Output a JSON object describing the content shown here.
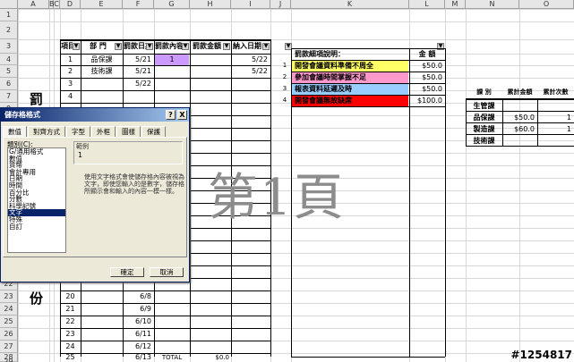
{
  "columns": [
    "A",
    "B",
    "C",
    "D",
    "E",
    "F",
    "G",
    "H",
    "I",
    "J",
    "K",
    "L",
    "M",
    "N",
    "O"
  ],
  "rows": [
    "1",
    "2",
    "3",
    "4",
    "5",
    "6",
    "7",
    "8",
    "9",
    "10",
    "11",
    "12",
    "13",
    "14",
    "15",
    "16",
    "17",
    "18",
    "19",
    "20",
    "21",
    "22",
    "23",
    "24",
    "25",
    "26",
    "27",
    "28",
    "29"
  ],
  "main_table": {
    "headers": [
      "項目",
      "部 門",
      "罰款日期",
      "罰款內容",
      "罰款金額",
      "納入日期"
    ],
    "rows": [
      [
        "1",
        "品保課",
        "5/21",
        "1",
        "",
        "5/22"
      ],
      [
        "2",
        "技術課",
        "5/21",
        "",
        "",
        "5/22"
      ],
      [
        "3",
        "",
        "5/22",
        "",
        "",
        ""
      ],
      [
        "4",
        "",
        "",
        "",
        "",
        ""
      ],
      [
        "20",
        "",
        "6/8",
        "",
        "",
        ""
      ],
      [
        "21",
        "",
        "6/9",
        "",
        "",
        ""
      ],
      [
        "22",
        "",
        "6/10",
        "",
        "",
        ""
      ],
      [
        "23",
        "",
        "6/11",
        "",
        "",
        ""
      ],
      [
        "24",
        "",
        "6/12",
        "",
        "",
        ""
      ],
      [
        "25",
        "",
        "6/13",
        "",
        "",
        ""
      ]
    ],
    "total_label": "TOTAL",
    "total_value": "$0.0"
  },
  "fine_desc": {
    "header_desc": "罰款細項說明：",
    "header_amount": "金 額",
    "items": [
      {
        "no": "1",
        "text": "開發會議資料準備不周全",
        "amount": "$50.0",
        "color": "#ffff66"
      },
      {
        "no": "2",
        "text": "參加會議時間掌握不足",
        "amount": "$50.0",
        "color": "#ff99cc"
      },
      {
        "no": "3",
        "text": "報表資料延遲及時",
        "amount": "$50.0",
        "color": "#99ccff"
      },
      {
        "no": "4",
        "text": "開發會議無故缺席",
        "amount": "$100.0",
        "color": "#ff0000"
      }
    ]
  },
  "summary": {
    "headers": [
      "課 別",
      "累計金額",
      "累計次數"
    ],
    "rows": [
      [
        "生管課",
        "",
        ""
      ],
      [
        "品保課",
        "$50.0",
        "1"
      ],
      [
        "製造課",
        "$60.0",
        "1"
      ],
      [
        "技術課",
        "",
        ""
      ]
    ]
  },
  "vertical_text_1": "罰",
  "vertical_text_2": "份",
  "page_watermark": "第1頁",
  "stamp": "#1254817",
  "dialog": {
    "title": "儲存格格式",
    "help_btn": "?",
    "close_btn": "X",
    "tabs": [
      "數值",
      "對齊方式",
      "字型",
      "外框",
      "圖樣",
      "保護"
    ],
    "category_label": "類別(C):",
    "categories": [
      "G/通用格式",
      "數值",
      "貨幣",
      "會計專用",
      "日期",
      "時間",
      "百分比",
      "分數",
      "科學記號",
      "文字",
      "特殊",
      "自訂"
    ],
    "selected_index": 9,
    "sample_label": "範例",
    "sample_value": "1",
    "description": "使用文字格式會使儲存格內容被視為文字，即使您輸入的是數字，儲存格所顯示會和輸入的內容一模一樣。",
    "ok": "確定",
    "cancel": "取消"
  }
}
